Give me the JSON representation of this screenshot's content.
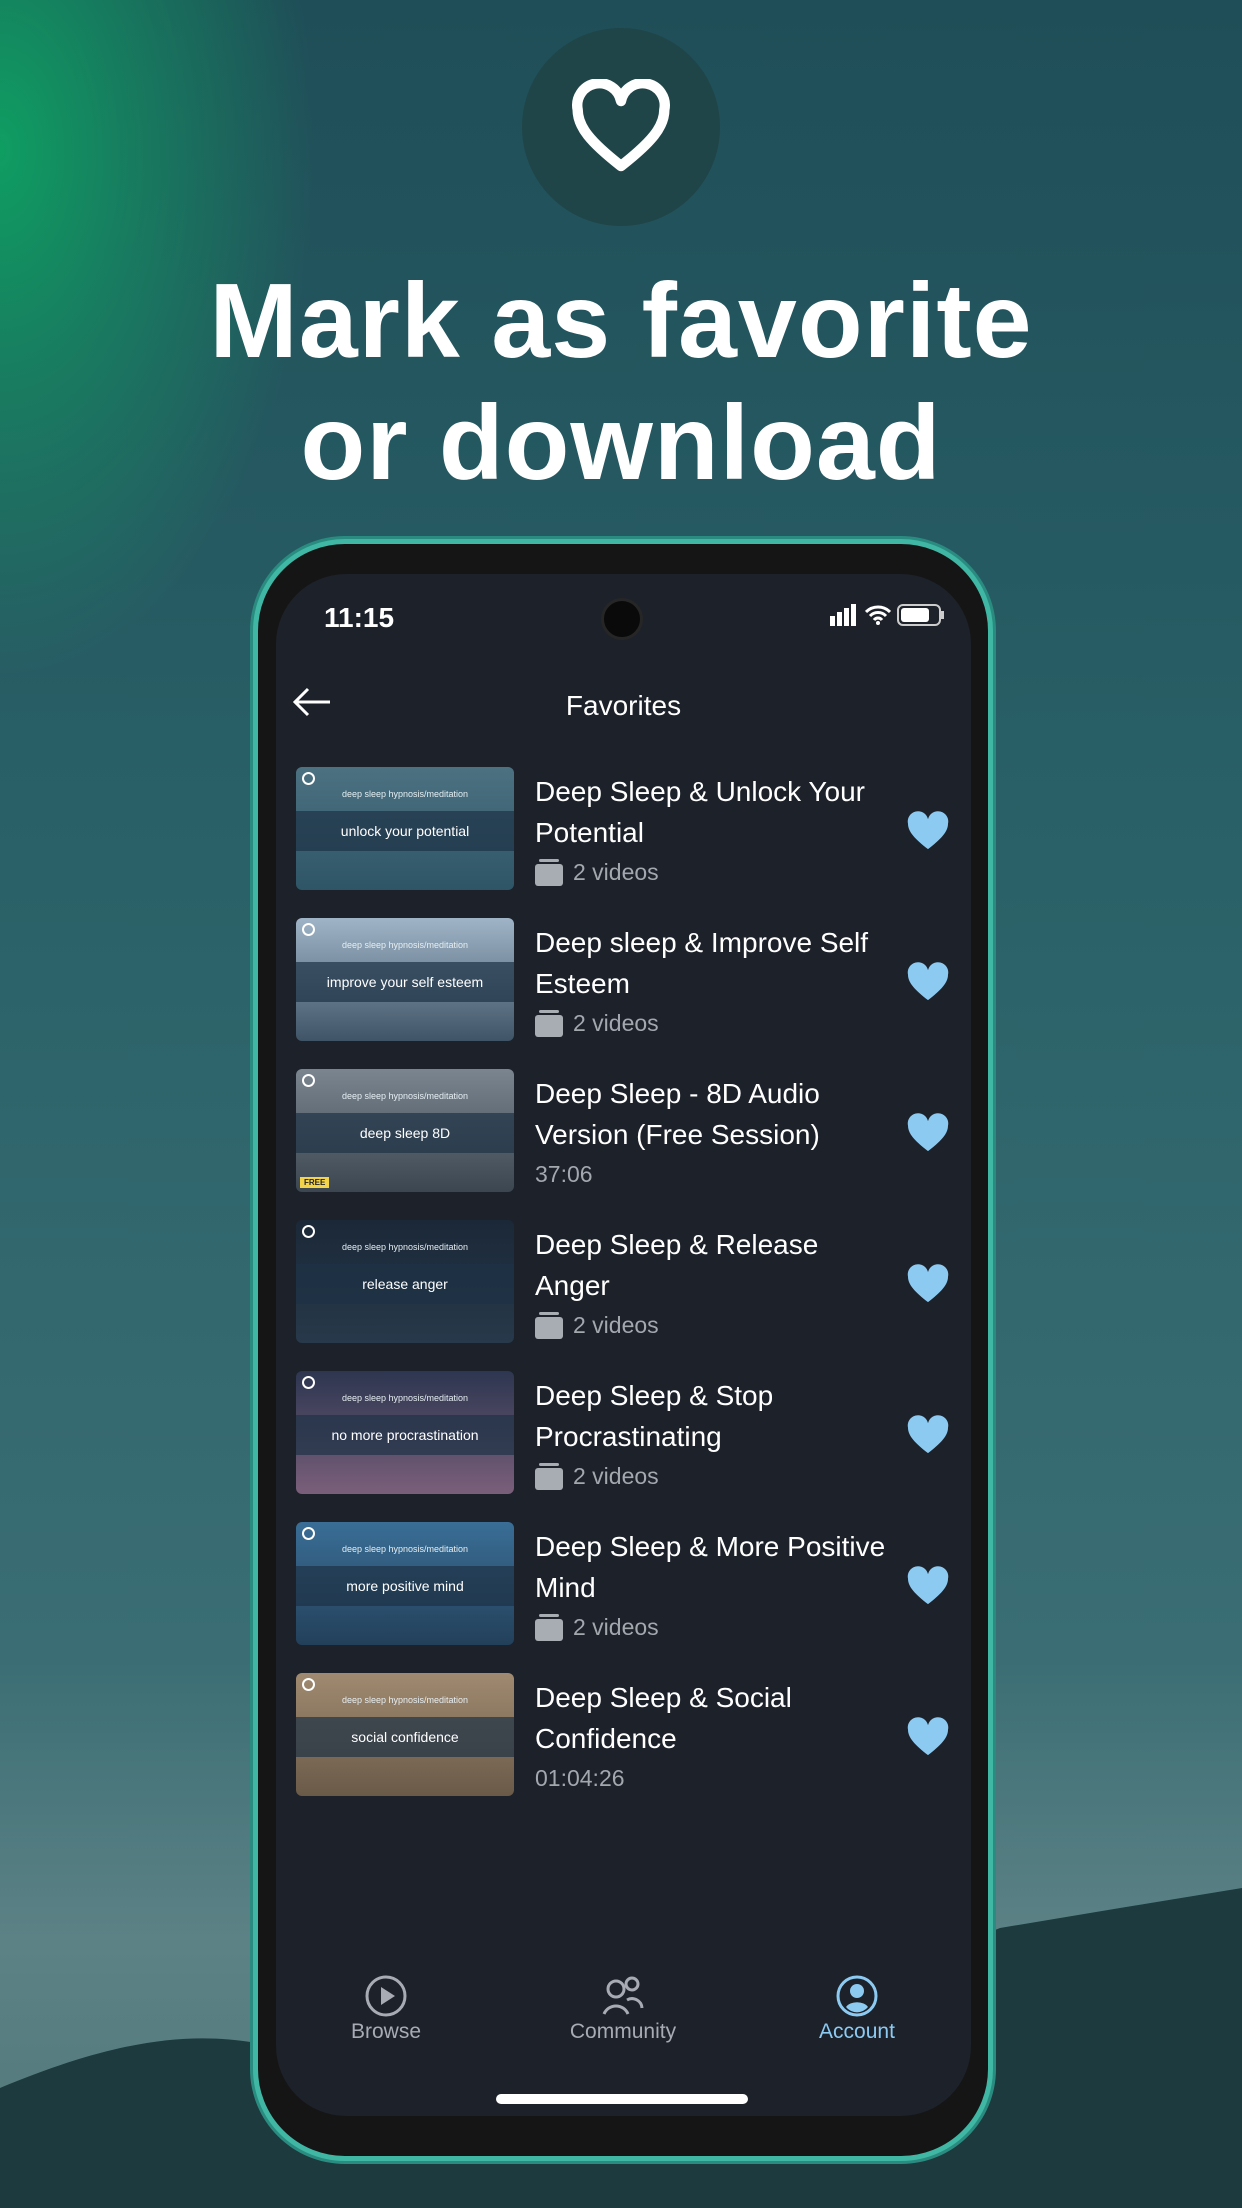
{
  "promo": {
    "headline_line1": "Mark as favorite",
    "headline_line2": "or download",
    "icon": "heart-icon"
  },
  "status_bar": {
    "time": "11:15"
  },
  "header": {
    "title": "Favorites",
    "back_icon": "arrow-left-icon"
  },
  "items": [
    {
      "title": "Deep Sleep & Unlock Your Potential",
      "subtitle": "2 videos",
      "kind": "playlist",
      "thumb_caption": "deep sleep hypnosis/meditation",
      "thumb_label": "unlock your potential",
      "colors": [
        "#4c7282",
        "#2e5566"
      ],
      "favorited": true
    },
    {
      "title": "Deep sleep & Improve Self Esteem",
      "subtitle": "2 videos",
      "kind": "playlist",
      "thumb_caption": "deep sleep hypnosis/meditation",
      "thumb_label": "improve your self esteem",
      "colors": [
        "#9fb4c6",
        "#3f5466"
      ],
      "favorited": true
    },
    {
      "title": "Deep Sleep - 8D Audio Version (Free Session)",
      "subtitle": "37:06",
      "kind": "single",
      "thumb_caption": "deep sleep hypnosis/meditation",
      "thumb_label": "deep sleep 8D",
      "badge": "FREE",
      "colors": [
        "#7a8590",
        "#3c4650"
      ],
      "favorited": true
    },
    {
      "title": "Deep Sleep & Release Anger",
      "subtitle": "2 videos",
      "kind": "playlist",
      "thumb_caption": "deep sleep hypnosis/meditation",
      "thumb_label": "release anger",
      "colors": [
        "#1b2838",
        "#27394a"
      ],
      "favorited": true
    },
    {
      "title": "Deep Sleep & Stop Procrastinating",
      "subtitle": "2 videos",
      "kind": "playlist",
      "thumb_caption": "deep sleep hypnosis/meditation",
      "thumb_label": "no more procrastination",
      "colors": [
        "#2d3650",
        "#7a5f7a"
      ],
      "favorited": true
    },
    {
      "title": "Deep Sleep & More Positive Mind",
      "subtitle": "2 videos",
      "kind": "playlist",
      "thumb_caption": "deep sleep hypnosis/meditation",
      "thumb_label": "more positive mind",
      "colors": [
        "#3a6e96",
        "#23405a"
      ],
      "favorited": true
    },
    {
      "title": "Deep Sleep & Social Confidence",
      "subtitle": "01:04:26",
      "kind": "single",
      "thumb_caption": "deep sleep hypnosis/meditation",
      "thumb_label": "social confidence",
      "colors": [
        "#a08a70",
        "#6a5a48"
      ],
      "favorited": true
    }
  ],
  "bottom_nav": [
    {
      "label": "Browse",
      "icon": "play-circle-icon",
      "active": false
    },
    {
      "label": "Community",
      "icon": "people-icon",
      "active": false
    },
    {
      "label": "Account",
      "icon": "account-circle-icon",
      "active": true
    }
  ],
  "colors": {
    "accent": "#8ccaf2",
    "screen_bg": "#1c212a",
    "heart": "#8ccaf2"
  }
}
